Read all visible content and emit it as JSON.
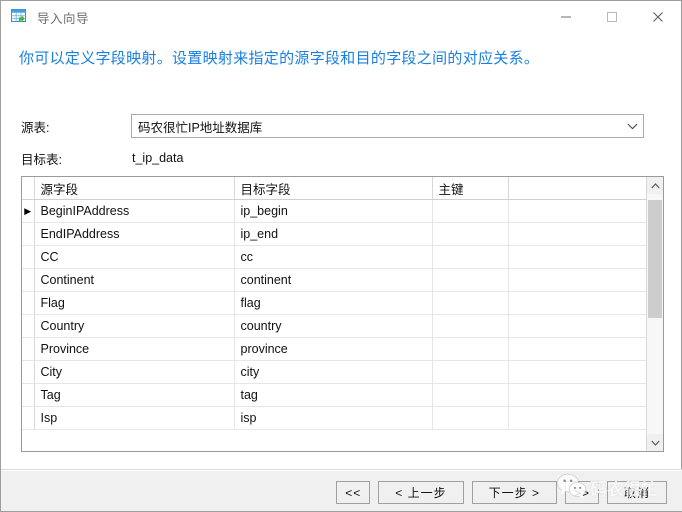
{
  "window": {
    "title": "导入向导",
    "icon": "import-table-icon",
    "controls": {
      "minimize": "—",
      "maximize": "□",
      "close": "✕"
    }
  },
  "header": {
    "blurb": "你可以定义字段映射。设置映射来指定的源字段和目的字段之间的对应关系。",
    "blurb_color": "#1a7fe0"
  },
  "form": {
    "source_table": {
      "label": "源表:",
      "value": "码农很忙IP地址数据库",
      "arrow": "⌄"
    },
    "target_table": {
      "label": "目标表:",
      "value": "t_ip_data"
    }
  },
  "grid": {
    "columns": [
      "源字段",
      "目标字段",
      "主键"
    ],
    "selected_row_index": 0,
    "row_indicator": "▶",
    "rows": [
      {
        "source": "BeginIPAddress",
        "target": "ip_begin",
        "key": ""
      },
      {
        "source": "EndIPAddress",
        "target": "ip_end",
        "key": ""
      },
      {
        "source": "CC",
        "target": "cc",
        "key": ""
      },
      {
        "source": "Continent",
        "target": "continent",
        "key": ""
      },
      {
        "source": "Flag",
        "target": "flag",
        "key": ""
      },
      {
        "source": "Country",
        "target": "country",
        "key": ""
      },
      {
        "source": "Province",
        "target": "province",
        "key": ""
      },
      {
        "source": "City",
        "target": "city",
        "key": ""
      },
      {
        "source": "Tag",
        "target": "tag",
        "key": ""
      },
      {
        "source": "Isp",
        "target": "isp",
        "key": ""
      }
    ],
    "scrollbar": {
      "up": "▲",
      "down": "▼"
    }
  },
  "footer": {
    "buttons": [
      {
        "name": "first-button",
        "label": "<<"
      },
      {
        "name": "previous-button",
        "label": "< 上一步"
      },
      {
        "name": "next-button",
        "label": "下一步 >"
      },
      {
        "name": "last-button",
        "label": ">>"
      },
      {
        "name": "cancel-button",
        "label": "取消"
      }
    ]
  },
  "watermark": {
    "text": "码农很忙",
    "logo": "wechat-logo"
  }
}
